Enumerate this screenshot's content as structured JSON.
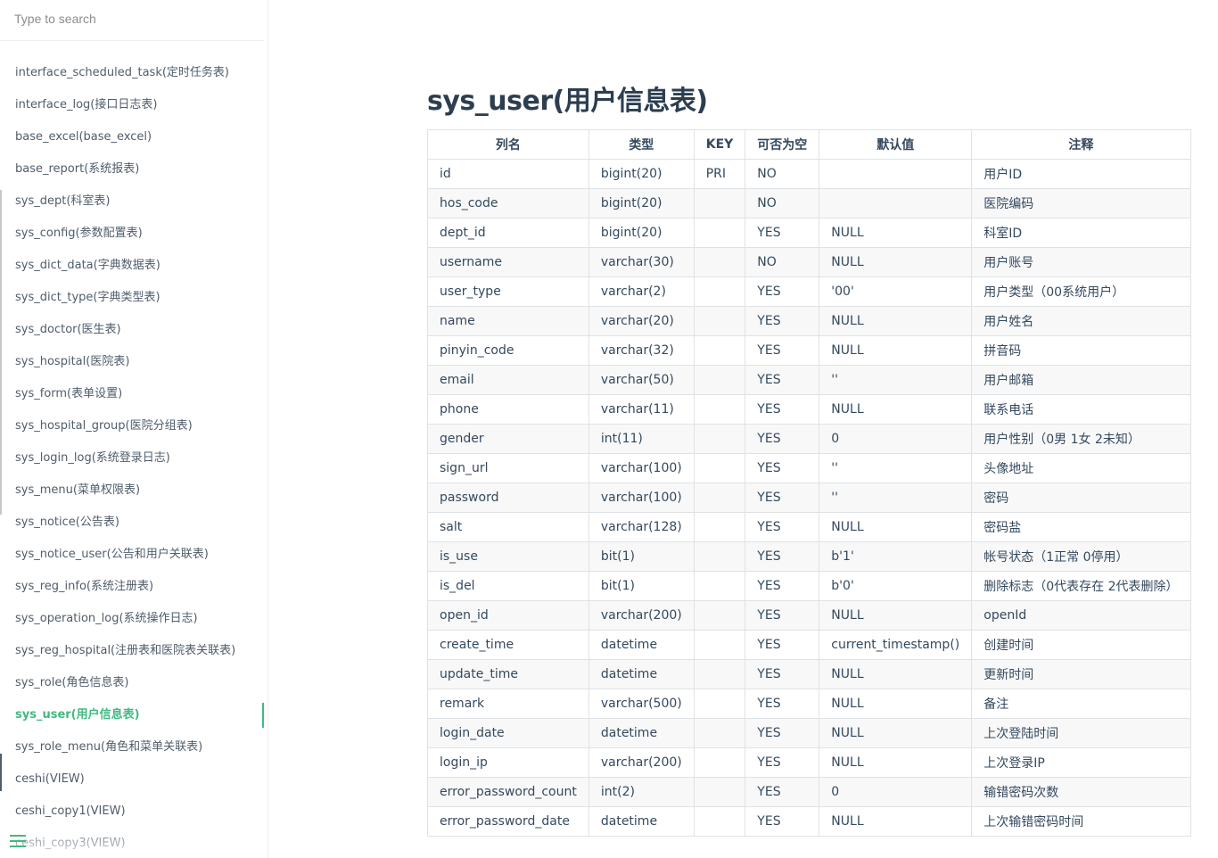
{
  "search": {
    "placeholder": "Type to search"
  },
  "sidebar": {
    "items": [
      "interface_scheduled_task(定时任务表)",
      "interface_log(接口日志表)",
      "base_excel(base_excel)",
      "base_report(系统报表)",
      "sys_dept(科室表)",
      "sys_config(参数配置表)",
      "sys_dict_data(字典数据表)",
      "sys_dict_type(字典类型表)",
      "sys_doctor(医生表)",
      "sys_hospital(医院表)",
      "sys_form(表单设置)",
      "sys_hospital_group(医院分组表)",
      "sys_login_log(系统登录日志)",
      "sys_menu(菜单权限表)",
      "sys_notice(公告表)",
      "sys_notice_user(公告和用户关联表)",
      "sys_reg_info(系统注册表)",
      "sys_operation_log(系统操作日志)",
      "sys_reg_hospital(注册表和医院表关联表)",
      "sys_role(角色信息表)",
      "sys_user(用户信息表)",
      "sys_role_menu(角色和菜单关联表)",
      "ceshi(VIEW)",
      "ceshi_copy1(VIEW)",
      "ceshi_copy3(VIEW)"
    ],
    "active": "sys_user(用户信息表)",
    "accent_color": "#42b983",
    "menu_icon": "hamburger-menu-icon"
  },
  "main": {
    "title": "sys_user(用户信息表)",
    "columns": [
      "列名",
      "类型",
      "KEY",
      "可否为空",
      "默认值",
      "注释"
    ],
    "rows": [
      [
        "id",
        "bigint(20)",
        "PRI",
        "NO",
        "",
        "用户ID"
      ],
      [
        "hos_code",
        "bigint(20)",
        "",
        "NO",
        "",
        "医院编码"
      ],
      [
        "dept_id",
        "bigint(20)",
        "",
        "YES",
        "NULL",
        "科室ID"
      ],
      [
        "username",
        "varchar(30)",
        "",
        "NO",
        "NULL",
        "用户账号"
      ],
      [
        "user_type",
        "varchar(2)",
        "",
        "YES",
        "'00'",
        "用户类型（00系统用户）"
      ],
      [
        "name",
        "varchar(20)",
        "",
        "YES",
        "NULL",
        "用户姓名"
      ],
      [
        "pinyin_code",
        "varchar(32)",
        "",
        "YES",
        "NULL",
        "拼音码"
      ],
      [
        "email",
        "varchar(50)",
        "",
        "YES",
        "''",
        "用户邮箱"
      ],
      [
        "phone",
        "varchar(11)",
        "",
        "YES",
        "NULL",
        "联系电话"
      ],
      [
        "gender",
        "int(11)",
        "",
        "YES",
        "0",
        "用户性别（0男 1女 2未知）"
      ],
      [
        "sign_url",
        "varchar(100)",
        "",
        "YES",
        "''",
        "头像地址"
      ],
      [
        "password",
        "varchar(100)",
        "",
        "YES",
        "''",
        "密码"
      ],
      [
        "salt",
        "varchar(128)",
        "",
        "YES",
        "NULL",
        "密码盐"
      ],
      [
        "is_use",
        "bit(1)",
        "",
        "YES",
        "b'1'",
        "帐号状态（1正常 0停用）"
      ],
      [
        "is_del",
        "bit(1)",
        "",
        "YES",
        "b'0'",
        "删除标志（0代表存在 2代表删除）"
      ],
      [
        "open_id",
        "varchar(200)",
        "",
        "YES",
        "NULL",
        "openId"
      ],
      [
        "create_time",
        "datetime",
        "",
        "YES",
        "current_timestamp()",
        "创建时间"
      ],
      [
        "update_time",
        "datetime",
        "",
        "YES",
        "NULL",
        "更新时间"
      ],
      [
        "remark",
        "varchar(500)",
        "",
        "YES",
        "NULL",
        "备注"
      ],
      [
        "login_date",
        "datetime",
        "",
        "YES",
        "NULL",
        "上次登陆时间"
      ],
      [
        "login_ip",
        "varchar(200)",
        "",
        "YES",
        "NULL",
        "上次登录IP"
      ],
      [
        "error_password_count",
        "int(2)",
        "",
        "YES",
        "0",
        "输错密码次数"
      ],
      [
        "error_password_date",
        "datetime",
        "",
        "YES",
        "NULL",
        "上次输错密码时间"
      ]
    ]
  }
}
